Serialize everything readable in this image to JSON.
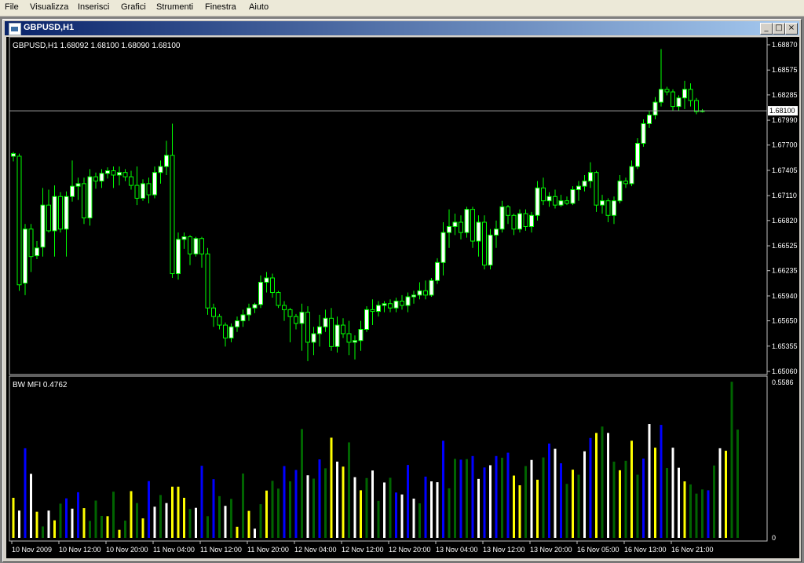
{
  "menu": [
    "File",
    "Visualizza",
    "Inserisci",
    "Grafici",
    "Strumenti",
    "Finestra",
    "Aiuto"
  ],
  "window": {
    "title": "GBPUSD,H1",
    "buttons": [
      "_",
      "□",
      "×"
    ]
  },
  "price_panel": {
    "label": "GBPUSD,H1  1.68092 1.68100 1.68090 1.68100",
    "current_price": "1.68100",
    "ticks": [
      "1.68870",
      "1.68575",
      "1.68285",
      "1.67990",
      "1.67700",
      "1.67405",
      "1.67110",
      "1.66820",
      "1.66525",
      "1.66235",
      "1.65940",
      "1.65650",
      "1.65355",
      "1.65060"
    ]
  },
  "mfi_panel": {
    "label": "BW MFI 0.4762",
    "ticks": [
      "0.5586",
      "0"
    ]
  },
  "time_labels": [
    "10 Nov 2009",
    "10 Nov 12:00",
    "10 Nov 20:00",
    "11 Nov 04:00",
    "11 Nov 12:00",
    "11 Nov 20:00",
    "12 Nov 04:00",
    "12 Nov 12:00",
    "12 Nov 20:00",
    "13 Nov 04:00",
    "13 Nov 12:00",
    "13 Nov 20:00",
    "16 Nov 05:00",
    "16 Nov 13:00",
    "16 Nov 21:00"
  ],
  "colors": {
    "bull": "#ffffff",
    "bear": "#000000",
    "wick": "#00ff00",
    "green": "#006400",
    "blue": "#0000ff",
    "yellow": "#ffff00",
    "white": "#ffffff",
    "grid": "#c0c0c0"
  },
  "chart_data": [
    {
      "type": "candlestick",
      "title": "GBPUSD,H1",
      "ylim": [
        1.6506,
        1.6887
      ],
      "candles": [
        {
          "o": 1.6757,
          "h": 1.6762,
          "l": 1.6751,
          "c": 1.676
        },
        {
          "o": 1.6757,
          "h": 1.676,
          "l": 1.66,
          "c": 1.6607
        },
        {
          "o": 1.6609,
          "h": 1.6678,
          "l": 1.6595,
          "c": 1.6672
        },
        {
          "o": 1.6672,
          "h": 1.6678,
          "l": 1.6622,
          "c": 1.664
        },
        {
          "o": 1.6641,
          "h": 1.6658,
          "l": 1.6637,
          "c": 1.665
        },
        {
          "o": 1.6651,
          "h": 1.672,
          "l": 1.664,
          "c": 1.67
        },
        {
          "o": 1.67,
          "h": 1.6718,
          "l": 1.6668,
          "c": 1.667
        },
        {
          "o": 1.667,
          "h": 1.6723,
          "l": 1.664,
          "c": 1.671
        },
        {
          "o": 1.671,
          "h": 1.6715,
          "l": 1.6668,
          "c": 1.6672
        },
        {
          "o": 1.6672,
          "h": 1.6716,
          "l": 1.664,
          "c": 1.671
        },
        {
          "o": 1.671,
          "h": 1.6752,
          "l": 1.6704,
          "c": 1.6722
        },
        {
          "o": 1.6722,
          "h": 1.6732,
          "l": 1.6706,
          "c": 1.6725
        },
        {
          "o": 1.6725,
          "h": 1.6732,
          "l": 1.6678,
          "c": 1.6685
        },
        {
          "o": 1.6685,
          "h": 1.6742,
          "l": 1.6676,
          "c": 1.6733
        },
        {
          "o": 1.6733,
          "h": 1.6738,
          "l": 1.6719,
          "c": 1.6728
        },
        {
          "o": 1.6728,
          "h": 1.6742,
          "l": 1.672,
          "c": 1.6737
        },
        {
          "o": 1.6737,
          "h": 1.6744,
          "l": 1.6731,
          "c": 1.674
        },
        {
          "o": 1.674,
          "h": 1.6745,
          "l": 1.672,
          "c": 1.6735
        },
        {
          "o": 1.6735,
          "h": 1.6745,
          "l": 1.6723,
          "c": 1.6738
        },
        {
          "o": 1.6738,
          "h": 1.6742,
          "l": 1.6728,
          "c": 1.6733
        },
        {
          "o": 1.6733,
          "h": 1.674,
          "l": 1.6718,
          "c": 1.6723
        },
        {
          "o": 1.6723,
          "h": 1.6745,
          "l": 1.67,
          "c": 1.6708
        },
        {
          "o": 1.6708,
          "h": 1.673,
          "l": 1.6705,
          "c": 1.6725
        },
        {
          "o": 1.6725,
          "h": 1.6732,
          "l": 1.6702,
          "c": 1.6712
        },
        {
          "o": 1.6712,
          "h": 1.6745,
          "l": 1.6708,
          "c": 1.6738
        },
        {
          "o": 1.6738,
          "h": 1.6752,
          "l": 1.6725,
          "c": 1.6745
        },
        {
          "o": 1.6745,
          "h": 1.6775,
          "l": 1.6735,
          "c": 1.6758
        },
        {
          "o": 1.6758,
          "h": 1.6795,
          "l": 1.6615,
          "c": 1.662
        },
        {
          "o": 1.662,
          "h": 1.6668,
          "l": 1.6613,
          "c": 1.666
        },
        {
          "o": 1.666,
          "h": 1.6668,
          "l": 1.6649,
          "c": 1.6663
        },
        {
          "o": 1.6663,
          "h": 1.6665,
          "l": 1.663,
          "c": 1.6643
        },
        {
          "o": 1.6643,
          "h": 1.6663,
          "l": 1.664,
          "c": 1.6661
        },
        {
          "o": 1.6661,
          "h": 1.6663,
          "l": 1.6627,
          "c": 1.6643
        },
        {
          "o": 1.6643,
          "h": 1.665,
          "l": 1.6572,
          "c": 1.658
        },
        {
          "o": 1.658,
          "h": 1.6585,
          "l": 1.6558,
          "c": 1.657
        },
        {
          "o": 1.657,
          "h": 1.6573,
          "l": 1.6555,
          "c": 1.656
        },
        {
          "o": 1.656,
          "h": 1.6563,
          "l": 1.6535,
          "c": 1.6545
        },
        {
          "o": 1.6545,
          "h": 1.6562,
          "l": 1.654,
          "c": 1.6558
        },
        {
          "o": 1.6558,
          "h": 1.657,
          "l": 1.6552,
          "c": 1.6565
        },
        {
          "o": 1.6565,
          "h": 1.6578,
          "l": 1.6558,
          "c": 1.6572
        },
        {
          "o": 1.6572,
          "h": 1.6585,
          "l": 1.6565,
          "c": 1.658
        },
        {
          "o": 1.658,
          "h": 1.6586,
          "l": 1.6574,
          "c": 1.6584
        },
        {
          "o": 1.6584,
          "h": 1.6618,
          "l": 1.658,
          "c": 1.661
        },
        {
          "o": 1.661,
          "h": 1.6622,
          "l": 1.6598,
          "c": 1.6615
        },
        {
          "o": 1.6615,
          "h": 1.662,
          "l": 1.6592,
          "c": 1.6598
        },
        {
          "o": 1.6598,
          "h": 1.66,
          "l": 1.658,
          "c": 1.6583
        },
        {
          "o": 1.6583,
          "h": 1.6588,
          "l": 1.6565,
          "c": 1.6578
        },
        {
          "o": 1.6578,
          "h": 1.658,
          "l": 1.654,
          "c": 1.657
        },
        {
          "o": 1.657,
          "h": 1.6573,
          "l": 1.6555,
          "c": 1.6562
        },
        {
          "o": 1.6562,
          "h": 1.6585,
          "l": 1.653,
          "c": 1.6575
        },
        {
          "o": 1.6575,
          "h": 1.6582,
          "l": 1.6518,
          "c": 1.654
        },
        {
          "o": 1.654,
          "h": 1.6558,
          "l": 1.6525,
          "c": 1.655
        },
        {
          "o": 1.655,
          "h": 1.6572,
          "l": 1.6535,
          "c": 1.6558
        },
        {
          "o": 1.6558,
          "h": 1.6578,
          "l": 1.6552,
          "c": 1.6568
        },
        {
          "o": 1.6568,
          "h": 1.658,
          "l": 1.653,
          "c": 1.6535
        },
        {
          "o": 1.6535,
          "h": 1.657,
          "l": 1.6528,
          "c": 1.656
        },
        {
          "o": 1.656,
          "h": 1.6568,
          "l": 1.6545,
          "c": 1.655
        },
        {
          "o": 1.655,
          "h": 1.6565,
          "l": 1.6525,
          "c": 1.654
        },
        {
          "o": 1.654,
          "h": 1.6548,
          "l": 1.652,
          "c": 1.6542
        },
        {
          "o": 1.6542,
          "h": 1.6565,
          "l": 1.653,
          "c": 1.6555
        },
        {
          "o": 1.6555,
          "h": 1.6582,
          "l": 1.6552,
          "c": 1.6578
        },
        {
          "o": 1.6578,
          "h": 1.659,
          "l": 1.656,
          "c": 1.6576
        },
        {
          "o": 1.6576,
          "h": 1.6588,
          "l": 1.657,
          "c": 1.6583
        },
        {
          "o": 1.6583,
          "h": 1.6588,
          "l": 1.6575,
          "c": 1.6585
        },
        {
          "o": 1.6585,
          "h": 1.659,
          "l": 1.6575,
          "c": 1.658
        },
        {
          "o": 1.658,
          "h": 1.6592,
          "l": 1.6575,
          "c": 1.6588
        },
        {
          "o": 1.6588,
          "h": 1.6595,
          "l": 1.6578,
          "c": 1.6583
        },
        {
          "o": 1.6583,
          "h": 1.6598,
          "l": 1.6575,
          "c": 1.6593
        },
        {
          "o": 1.6593,
          "h": 1.66,
          "l": 1.6585,
          "c": 1.6595
        },
        {
          "o": 1.6595,
          "h": 1.661,
          "l": 1.659,
          "c": 1.66
        },
        {
          "o": 1.66,
          "h": 1.6612,
          "l": 1.659,
          "c": 1.6595
        },
        {
          "o": 1.6595,
          "h": 1.6615,
          "l": 1.6593,
          "c": 1.6612
        },
        {
          "o": 1.6612,
          "h": 1.6638,
          "l": 1.6608,
          "c": 1.6633
        },
        {
          "o": 1.6633,
          "h": 1.668,
          "l": 1.6618,
          "c": 1.6668
        },
        {
          "o": 1.6668,
          "h": 1.6695,
          "l": 1.665,
          "c": 1.6675
        },
        {
          "o": 1.6675,
          "h": 1.669,
          "l": 1.6665,
          "c": 1.668
        },
        {
          "o": 1.668,
          "h": 1.6688,
          "l": 1.666,
          "c": 1.6668
        },
        {
          "o": 1.6668,
          "h": 1.6698,
          "l": 1.6662,
          "c": 1.6695
        },
        {
          "o": 1.6695,
          "h": 1.6698,
          "l": 1.665,
          "c": 1.6658
        },
        {
          "o": 1.6658,
          "h": 1.6688,
          "l": 1.664,
          "c": 1.668
        },
        {
          "o": 1.668,
          "h": 1.6688,
          "l": 1.6625,
          "c": 1.663
        },
        {
          "o": 1.663,
          "h": 1.6672,
          "l": 1.6625,
          "c": 1.6665
        },
        {
          "o": 1.6665,
          "h": 1.6682,
          "l": 1.665,
          "c": 1.6672
        },
        {
          "o": 1.6672,
          "h": 1.6705,
          "l": 1.6668,
          "c": 1.6698
        },
        {
          "o": 1.6698,
          "h": 1.67,
          "l": 1.6678,
          "c": 1.6688
        },
        {
          "o": 1.6688,
          "h": 1.669,
          "l": 1.6665,
          "c": 1.6672
        },
        {
          "o": 1.6672,
          "h": 1.6695,
          "l": 1.6668,
          "c": 1.669
        },
        {
          "o": 1.669,
          "h": 1.6695,
          "l": 1.667,
          "c": 1.6675
        },
        {
          "o": 1.6675,
          "h": 1.6692,
          "l": 1.6668,
          "c": 1.6688
        },
        {
          "o": 1.6688,
          "h": 1.6728,
          "l": 1.6682,
          "c": 1.672
        },
        {
          "o": 1.672,
          "h": 1.6732,
          "l": 1.67,
          "c": 1.6705
        },
        {
          "o": 1.6705,
          "h": 1.6715,
          "l": 1.6698,
          "c": 1.671
        },
        {
          "o": 1.671,
          "h": 1.6718,
          "l": 1.6696,
          "c": 1.67
        },
        {
          "o": 1.67,
          "h": 1.6712,
          "l": 1.6698,
          "c": 1.6705
        },
        {
          "o": 1.6705,
          "h": 1.671,
          "l": 1.67,
          "c": 1.6702
        },
        {
          "o": 1.6702,
          "h": 1.6722,
          "l": 1.67,
          "c": 1.6718
        },
        {
          "o": 1.6718,
          "h": 1.6728,
          "l": 1.6705,
          "c": 1.6722
        },
        {
          "o": 1.6722,
          "h": 1.6735,
          "l": 1.6716,
          "c": 1.6728
        },
        {
          "o": 1.6728,
          "h": 1.675,
          "l": 1.672,
          "c": 1.6738
        },
        {
          "o": 1.6738,
          "h": 1.674,
          "l": 1.6692,
          "c": 1.67
        },
        {
          "o": 1.67,
          "h": 1.6712,
          "l": 1.669,
          "c": 1.6705
        },
        {
          "o": 1.6705,
          "h": 1.6708,
          "l": 1.668,
          "c": 1.6688
        },
        {
          "o": 1.6688,
          "h": 1.671,
          "l": 1.6678,
          "c": 1.6705
        },
        {
          "o": 1.6705,
          "h": 1.6735,
          "l": 1.6702,
          "c": 1.6728
        },
        {
          "o": 1.6728,
          "h": 1.6732,
          "l": 1.672,
          "c": 1.6725
        },
        {
          "o": 1.6725,
          "h": 1.6752,
          "l": 1.6722,
          "c": 1.6745
        },
        {
          "o": 1.6745,
          "h": 1.6778,
          "l": 1.6742,
          "c": 1.6772
        },
        {
          "o": 1.6772,
          "h": 1.68,
          "l": 1.6768,
          "c": 1.6795
        },
        {
          "o": 1.6795,
          "h": 1.681,
          "l": 1.679,
          "c": 1.6805
        },
        {
          "o": 1.6805,
          "h": 1.6826,
          "l": 1.68,
          "c": 1.682
        },
        {
          "o": 1.682,
          "h": 1.6882,
          "l": 1.6815,
          "c": 1.6835
        },
        {
          "o": 1.6835,
          "h": 1.6838,
          "l": 1.6828,
          "c": 1.6832
        },
        {
          "o": 1.6832,
          "h": 1.6835,
          "l": 1.681,
          "c": 1.6815
        },
        {
          "o": 1.6815,
          "h": 1.6828,
          "l": 1.681,
          "c": 1.6825
        },
        {
          "o": 1.6825,
          "h": 1.6845,
          "l": 1.6812,
          "c": 1.6835
        },
        {
          "o": 1.6835,
          "h": 1.6842,
          "l": 1.6815,
          "c": 1.6822
        },
        {
          "o": 1.6822,
          "h": 1.6825,
          "l": 1.6806,
          "c": 1.6809
        },
        {
          "o": 1.6809,
          "h": 1.6812,
          "l": 1.6808,
          "c": 1.681
        }
      ]
    },
    {
      "type": "bar",
      "title": "BW MFI 0.4762",
      "ylim": [
        0,
        0.5586
      ],
      "values": [
        0.144,
        0.098,
        0.322,
        0.23,
        0.094,
        0.041,
        0.098,
        0.063,
        0.123,
        0.142,
        0.105,
        0.164,
        0.107,
        0.061,
        0.134,
        0.079,
        0.078,
        0.166,
        0.029,
        0.062,
        0.168,
        0.125,
        0.07,
        0.204,
        0.112,
        0.154,
        0.125,
        0.184,
        0.184,
        0.144,
        0.104,
        0.108,
        0.259,
        0.078,
        0.211,
        0.15,
        0.115,
        0.14,
        0.04,
        0.231,
        0.097,
        0.033,
        0.121,
        0.17,
        0.205,
        0.177,
        0.258,
        0.203,
        0.244,
        0.391,
        0.225,
        0.213,
        0.282,
        0.25,
        0.36,
        0.274,
        0.256,
        0.343,
        0.218,
        0.171,
        0.215,
        0.242,
        0.133,
        0.199,
        0.216,
        0.163,
        0.156,
        0.262,
        0.141,
        0.124,
        0.22,
        0.203,
        0.2,
        0.349,
        0.178,
        0.284,
        0.281,
        0.283,
        0.294,
        0.212,
        0.253,
        0.261,
        0.294,
        0.288,
        0.306,
        0.224,
        0.189,
        0.258,
        0.28,
        0.209,
        0.289,
        0.339,
        0.32,
        0.268,
        0.194,
        0.245,
        0.227,
        0.311,
        0.359,
        0.377,
        0.4,
        0.377,
        0.274,
        0.243,
        0.277,
        0.349,
        0.227,
        0.285,
        0.409,
        0.324,
        0.406,
        0.251,
        0.324,
        0.252,
        0.203,
        0.192,
        0.159,
        0.174,
        0.171,
        0.26,
        0.322,
        0.313,
        0.561,
        0.389,
        0.348,
        0.577
      ],
      "colors": [
        "yellow",
        "white",
        "blue",
        "white",
        "yellow",
        "green",
        "white",
        "yellow",
        "green",
        "blue",
        "white",
        "blue",
        "yellow",
        "green",
        "green",
        "green",
        "yellow",
        "green",
        "yellow",
        "green",
        "yellow",
        "green",
        "yellow",
        "blue",
        "white",
        "green",
        "white",
        "yellow",
        "yellow",
        "yellow",
        "green",
        "white",
        "blue",
        "green",
        "blue",
        "green",
        "white",
        "green",
        "yellow",
        "green",
        "yellow",
        "white",
        "green",
        "yellow",
        "green",
        "green",
        "blue",
        "green",
        "blue",
        "green",
        "white",
        "green",
        "blue",
        "green",
        "yellow",
        "white",
        "yellow",
        "green",
        "white",
        "yellow",
        "green",
        "white",
        "green",
        "white",
        "green",
        "blue",
        "white",
        "blue",
        "white",
        "green",
        "blue",
        "white",
        "white",
        "blue",
        "green",
        "green",
        "blue",
        "green",
        "blue",
        "white",
        "blue",
        "white",
        "blue",
        "green",
        "blue",
        "yellow",
        "yellow",
        "green",
        "white",
        "yellow",
        "green",
        "blue",
        "white",
        "blue",
        "green",
        "yellow",
        "green",
        "white",
        "blue",
        "yellow",
        "green",
        "white",
        "green",
        "yellow",
        "green",
        "yellow",
        "green",
        "blue",
        "white",
        "yellow",
        "blue",
        "green",
        "white",
        "white",
        "yellow",
        "green",
        "green",
        "green",
        "blue",
        "green",
        "white",
        "yellow",
        "green",
        "green"
      ]
    }
  ]
}
